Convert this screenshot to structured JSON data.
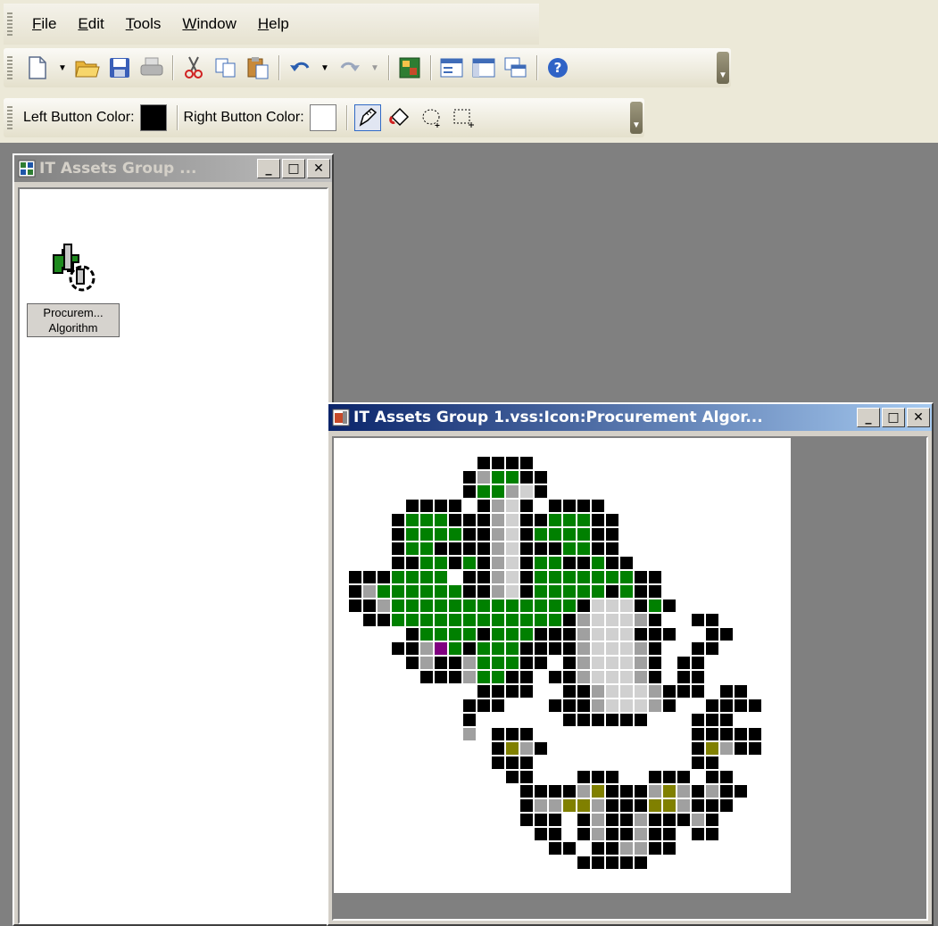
{
  "menubar": {
    "items": [
      {
        "label": "File",
        "mnemonic": "F",
        "rest": "ile"
      },
      {
        "label": "Edit",
        "mnemonic": "E",
        "rest": "dit"
      },
      {
        "label": "Tools",
        "mnemonic": "T",
        "rest": "ools"
      },
      {
        "label": "Window",
        "mnemonic": "W",
        "rest": "indow"
      },
      {
        "label": "Help",
        "mnemonic": "H",
        "rest": "elp"
      }
    ]
  },
  "standard_toolbar": {
    "buttons": [
      "new-icon",
      "open-folder-icon",
      "save-icon",
      "print-icon",
      "cut-icon",
      "copy-icon",
      "paste-icon",
      "undo-icon",
      "redo-icon",
      "stencil-icon",
      "properties-icon",
      "window-icon",
      "cascade-icon",
      "help-icon"
    ]
  },
  "color_toolbar": {
    "left_label": "Left Button Color:",
    "right_label": "Right Button Color:",
    "left_color": "#000000",
    "right_color": "#ffffff",
    "tools": [
      "pencil-icon",
      "fill-bucket-icon",
      "lasso-icon",
      "rectangle-select-icon"
    ]
  },
  "stencil_window": {
    "title": "IT Assets Group ...",
    "item_caption_line1": "Procurem...",
    "item_caption_line2": "Algorithm"
  },
  "icon_editor_window": {
    "title": "IT Assets Group 1.vss:Icon:Procurement Algor..."
  },
  "pixel_palette": {
    "K": "#000000",
    "G": "#008000",
    "g": "#a0a0a0",
    "w": "#d0d0d0",
    "O": "#808000",
    "P": "#800080"
  },
  "pixel_art": [
    "................................",
    ".........KKKK...................",
    "........KgGGKK..................",
    "........KGGgwK..................",
    "....KKKK.KgwK.KKKK..............",
    "...KGGGKKKgwKKGGGKK.............",
    "...KGGGGKKgwKGGGGKK.............",
    "...KGGKKKKgwKKKGGKK.............",
    "...KKGGKGKgwKGGKKGKK............",
    "KKKGGGG.KKgwKGGGGGGGKK..........",
    "KgGGGGGGKKgwKGGGGGKGKK..........",
    "KKgGGGGGGGGGGGGGKwwwKGK.........",
    ".KKGGGGGGGGGGGGKgwwwgK..KK......",
    "....KGGGGKGGGKKKgwwwKKK..KK.....",
    "...KKgPGKGGGKKKKgwwwgK..KK......",
    "....KgKKgGGGKK.KgwwwgK.KK.......",
    ".....KKKgGGKK.KKgwwwgK.KK.......",
    ".........KKKK..KKgwwwgKKK.KK....",
    "........KKK...KKKgwwwgK..KKKK...",
    "........K......KKKKKK...KKK.....",
    "........g.KKK...........KKKKK...",
    "..........KOgK..........KOgKK...",
    "..........KKK...........KK......",
    "...........KK...KKK..KKK.KK.....",
    "............KKKKgOKKKgOgKgKK....",
    "............KggOOgKKKOOgKKK.....",
    "............KKK.KgKKgKKKgK......",
    ".............KK.KgKKgKK.KK......",
    "..............KK.KKggKK.........",
    "................KKKKK...........",
    "................................",
    "................................"
  ]
}
